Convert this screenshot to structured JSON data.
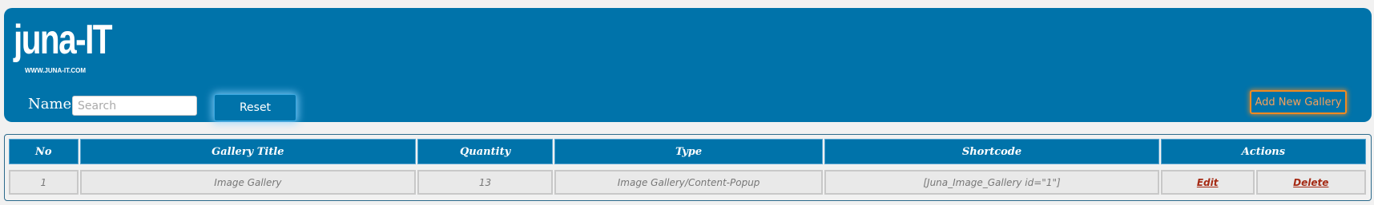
{
  "header": {
    "logo_title": "juna-IT",
    "logo_subtitle": "WWW.JUNA-IT.COM",
    "name_label": "Name:",
    "search": {
      "placeholder": "Search",
      "value": ""
    },
    "reset_label": "Reset",
    "add_new_label": "Add New Gallery"
  },
  "table": {
    "columns": [
      "No",
      "Gallery Title",
      "Quantity",
      "Type",
      "Shortcode",
      "Actions"
    ],
    "rows": [
      {
        "no": "1",
        "title": "Image Gallery",
        "quantity": "13",
        "type": "Image Gallery/Content-Popup",
        "shortcode": "[Juna_Image_Gallery id=\"1\"]",
        "edit_label": "Edit",
        "delete_label": "Delete"
      }
    ]
  },
  "colors": {
    "header_bg": "#0073aa",
    "accent_orange": "#f18a20",
    "link_red": "#a52a14",
    "page_bg": "#f1f1f1"
  }
}
